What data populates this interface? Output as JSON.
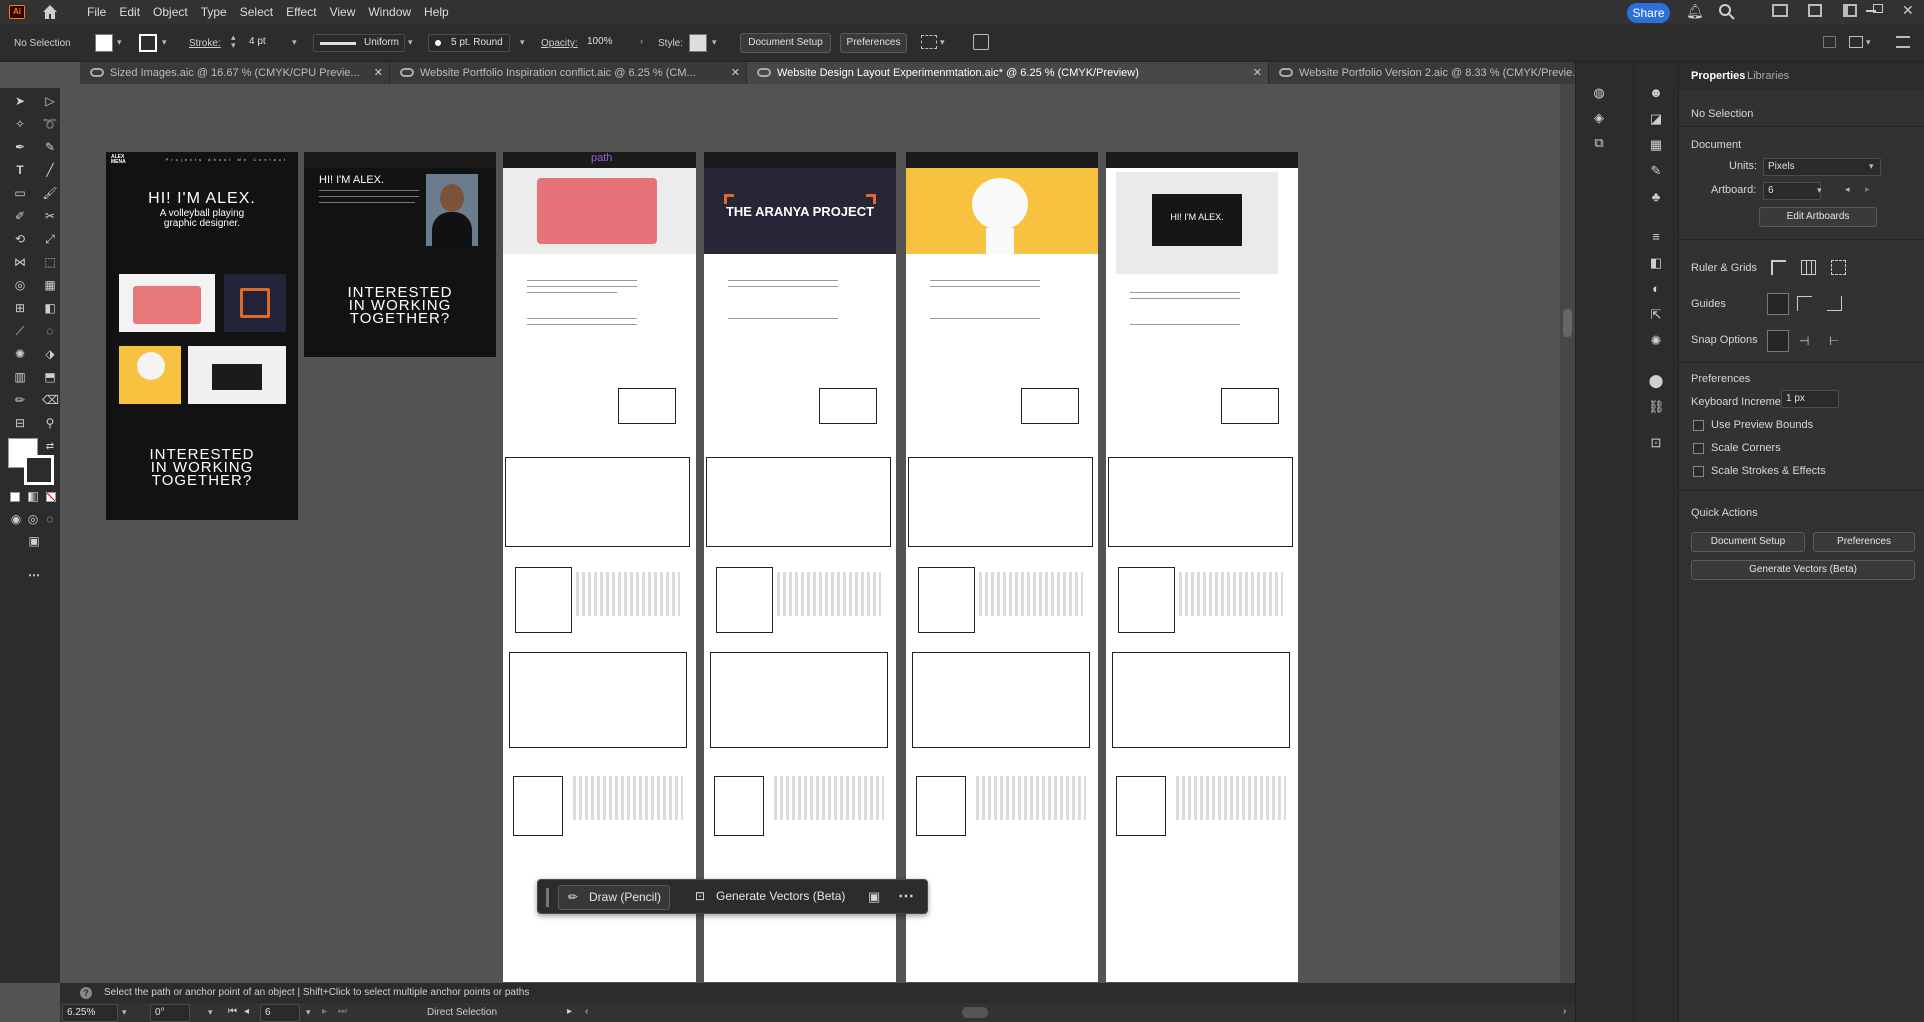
{
  "app": {
    "logo": "Ai",
    "share": "Share"
  },
  "menu": [
    "File",
    "Edit",
    "Object",
    "Type",
    "Select",
    "Effect",
    "View",
    "Window",
    "Help"
  ],
  "control": {
    "selection": "No Selection",
    "stroke_label": "Stroke:",
    "stroke_value": "4 pt",
    "profile": "Uniform",
    "brush": "5 pt. Round",
    "opacity_label": "Opacity:",
    "opacity_value": "100%",
    "style_label": "Style:",
    "doc_setup": "Document Setup",
    "preferences": "Preferences"
  },
  "tabs": [
    {
      "label": "Sized Images.aic @ 16.67 % (CMYK/CPU Previe..."
    },
    {
      "label": "Website Portfolio Inspiration conflict.aic @ 6.25 % (CM..."
    },
    {
      "label": "Website Design Layout Experimenmtation.aic* @ 6.25 % (CMYK/Preview)"
    },
    {
      "label": "Website Portfolio Version 2.aic @ 8.33 % (CMYK/Previe..."
    }
  ],
  "artboards": {
    "home": {
      "logo": "ALEX\nMENA",
      "nav": "Projects About Me Contact",
      "hero_title": "HI! I'M ALEX.",
      "hero_sub1": "A volleyball playing",
      "hero_sub2": "graphic designer.",
      "cta1": "INTERESTED",
      "cta2": "IN WORKING",
      "cta3": "TOGETHER?"
    },
    "about": {
      "title": "HI! I'M ALEX.",
      "cta1": "INTERESTED",
      "cta2": "IN WORKING",
      "cta3": "TOGETHER?"
    },
    "aranya": {
      "title": "THE ARANYA PROJECT"
    },
    "path": {
      "title": "path"
    },
    "laptop": {
      "title": "HI! I'M ALEX."
    }
  },
  "context_bar": {
    "draw": "Draw (Pencil)",
    "generate": "Generate Vectors (Beta)"
  },
  "hint": {
    "text": "Select the path or anchor point of an object  |  Shift+Click to select multiple anchor points or paths"
  },
  "status": {
    "zoom": "6.25%",
    "rotate": "0°",
    "artboard": "6",
    "tool": "Direct Selection"
  },
  "properties": {
    "tab_properties": "Properties",
    "tab_libraries": "Libraries",
    "no_selection": "No Selection",
    "document": "Document",
    "units_label": "Units:",
    "units_value": "Pixels",
    "artboard_label": "Artboard:",
    "artboard_value": "6",
    "edit_artboards": "Edit Artboards",
    "ruler_grids": "Ruler & Grids",
    "guides": "Guides",
    "snap_options": "Snap Options",
    "preferences": "Preferences",
    "kbd_increment_label": "Keyboard Increment:",
    "kbd_increment_value": "1 px",
    "use_preview_bounds": "Use Preview Bounds",
    "scale_corners": "Scale Corners",
    "scale_strokes": "Scale Strokes & Effects",
    "quick_actions": "Quick Actions",
    "doc_setup": "Document Setup",
    "prefs_btn": "Preferences",
    "generate": "Generate Vectors (Beta)"
  }
}
